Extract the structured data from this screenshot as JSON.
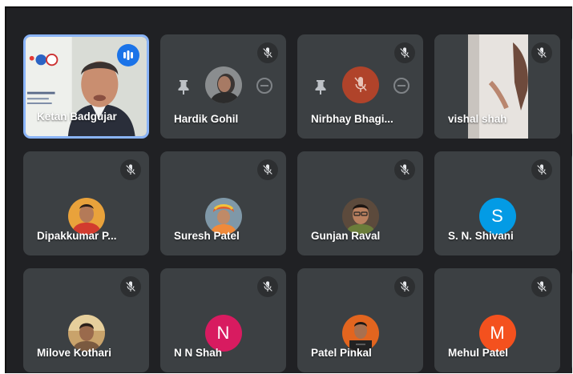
{
  "colors": {
    "background": "#202124",
    "tile": "#3c4043",
    "active_border": "#8ab4f8",
    "speaking_indicator": "#1a73e8"
  },
  "participants": [
    {
      "name": "Ketan Badgujar",
      "type": "video",
      "muted": false,
      "speaking": true
    },
    {
      "name": "Hardik Gohil",
      "type": "photo",
      "muted": true
    },
    {
      "name": "Nirbhay Bhagi...",
      "type": "photo",
      "muted": true
    },
    {
      "name": "vishal shah",
      "type": "video",
      "muted": true
    },
    {
      "name": "Dipakkumar P...",
      "type": "photo",
      "muted": true
    },
    {
      "name": "Suresh Patel",
      "type": "photo",
      "muted": true
    },
    {
      "name": "Gunjan Raval",
      "type": "photo",
      "muted": true
    },
    {
      "name": "S. N. Shivani",
      "type": "letter",
      "initial": "S",
      "color": "#039be5",
      "muted": true
    },
    {
      "name": "Milove Kothari",
      "type": "photo",
      "muted": true
    },
    {
      "name": "N N Shah",
      "type": "letter",
      "initial": "N",
      "color": "#d81b60",
      "muted": true
    },
    {
      "name": "Patel Pinkal",
      "type": "photo",
      "muted": true
    },
    {
      "name": "Mehul Patel",
      "type": "letter",
      "initial": "M",
      "color": "#f4511e",
      "muted": true
    }
  ]
}
